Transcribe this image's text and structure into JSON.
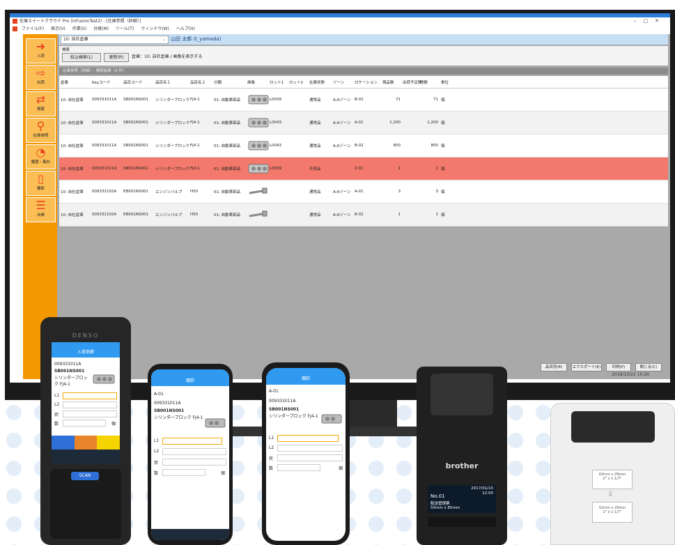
{
  "window": {
    "title": "在庫スイートクラウド Pro (InFusionTest2) - [在庫参照（詳細）]",
    "controls": [
      "–",
      "□",
      "✕"
    ],
    "menu": [
      "ファイル(F)",
      "表示(V)",
      "作業(S)",
      "台帳(M)",
      "ツール(T)",
      "ウィンドウ(W)",
      "ヘルプ(H)"
    ]
  },
  "sidebar": {
    "items": [
      {
        "label": "入荷",
        "icon": "arrow-in-icon"
      },
      {
        "label": "出荷",
        "icon": "arrow-out-icon"
      },
      {
        "label": "振替",
        "icon": "transfer-icon"
      },
      {
        "label": "在庫参照",
        "icon": "search-icon"
      },
      {
        "label": "履歴・集計",
        "icon": "chart-icon"
      },
      {
        "label": "棚卸",
        "icon": "clipboard-icon"
      },
      {
        "label": "台帳",
        "icon": "ledger-icon"
      }
    ]
  },
  "header": {
    "warehouse": "10: 自社倉庫",
    "user": "山田 太郎 (t_yamada)"
  },
  "search": {
    "label": "検索",
    "filter_button": "絞込検索(L)",
    "refresh_button": "更新(R)",
    "condition": "倉庫：10: 自社倉庫 / 画像を表示する"
  },
  "results": {
    "title": "在庫参照（詳細）- 検索結果（6 件）",
    "columns": [
      "倉庫",
      "Keyコード",
      "品目コード",
      "品目名１",
      "品目名２",
      "分類",
      "画像",
      "ロット1",
      "ロット2",
      "在庫状態",
      "ゾーン",
      "ロケーション",
      "現品数",
      "出荷予定数",
      "残数",
      "単位"
    ],
    "rows": [
      [
        "10: 自社倉庫",
        "009331011A",
        "SB001NS001",
        "シリンダーブロック",
        "FJ4-1",
        "01: 自動車部品",
        "block",
        "L0039",
        "",
        "通常品",
        "A:Aゾーン",
        "B-02",
        "71",
        "",
        "71",
        "個"
      ],
      [
        "10: 自社倉庫",
        "009331011A",
        "SB001NS001",
        "シリンダーブロック",
        "FJ4-1",
        "01: 自動車部品",
        "block",
        "L0043",
        "",
        "通常品",
        "A:Aゾーン",
        "A-01",
        "1,200",
        "",
        "1,200",
        "個"
      ],
      [
        "10: 自社倉庫",
        "009331011A",
        "SB001NS001",
        "シリンダーブロック",
        "FJ4-1",
        "01: 自動車部品",
        "block",
        "L0043",
        "",
        "通常品",
        "A:Aゾーン",
        "B-02",
        "800",
        "",
        "800",
        "個"
      ],
      [
        "10: 自社倉庫",
        "009331011A",
        "SB001NS001",
        "シリンダーブロック",
        "FJ4-1",
        "01: 自動車部品",
        "block",
        "L0039",
        "",
        "不良品",
        "",
        "Z-01",
        "1",
        "",
        "1",
        "個"
      ],
      [
        "10: 自社倉庫",
        "009332102A",
        "EB001NS001",
        "エンジンバルブ",
        "H50",
        "01: 自動車部品",
        "valve",
        "",
        "",
        "通常品",
        "A:Aゾーン",
        "A-01",
        "3",
        "",
        "3",
        "個"
      ],
      [
        "10: 自社倉庫",
        "009332102A",
        "EB001NS001",
        "エンジンバルブ",
        "H50",
        "01: 自動車部品",
        "valve",
        "",
        "",
        "通常品",
        "A:Aゾーン",
        "B-02",
        "1",
        "",
        "1",
        "個"
      ]
    ]
  },
  "footer": {
    "buttons": [
      "品目別(B)",
      "エクスポート(E)",
      "印刷(P)",
      "閉じる(C)"
    ],
    "datetime": "2018/10/22  10:20"
  },
  "handheld": {
    "brand": "DENSO",
    "title": "入荷実績",
    "code": "009331011A",
    "item_code": "SB001NS001",
    "item_name": "シリンダーブロック FJ4-1",
    "fields": [
      "L1",
      "L2",
      "状",
      "数"
    ],
    "unit": "個",
    "scan_label": "SCAN"
  },
  "phone1": {
    "title": "棚卸",
    "loc": "A-01",
    "code": "009331011A",
    "item_code": "SB001NS001",
    "item_name": "シリンダーブロック FJ4-1",
    "fields": [
      "L1",
      "L2",
      "状",
      "数"
    ],
    "unit": "個"
  },
  "phone2": {
    "title": "棚卸",
    "loc": "A-01",
    "code": "009331011A",
    "item_code": "SB001NS001",
    "item_name": "シリンダーブロック FJ4-1",
    "fields": [
      "L1",
      "L2",
      "状",
      "数"
    ],
    "unit": "個"
  },
  "printer1": {
    "brand": "brother",
    "screen_no": "No.01",
    "screen_line1": "配送管理票",
    "screen_line2": "50mm x 85mm",
    "screen_date": "2017/01/10",
    "screen_time": "12:00"
  },
  "printer2": {
    "label1_l1": "62mm x 29mm",
    "label1_l2": "2\" x 1-1/7\"",
    "label2_l1": "52mm x 29mm",
    "label2_l2": "2\" x 1-1/7\""
  },
  "colors": {
    "accent": "#2b7dd8",
    "sidebar": "#f39800",
    "highlight_row": "#f2796b"
  }
}
